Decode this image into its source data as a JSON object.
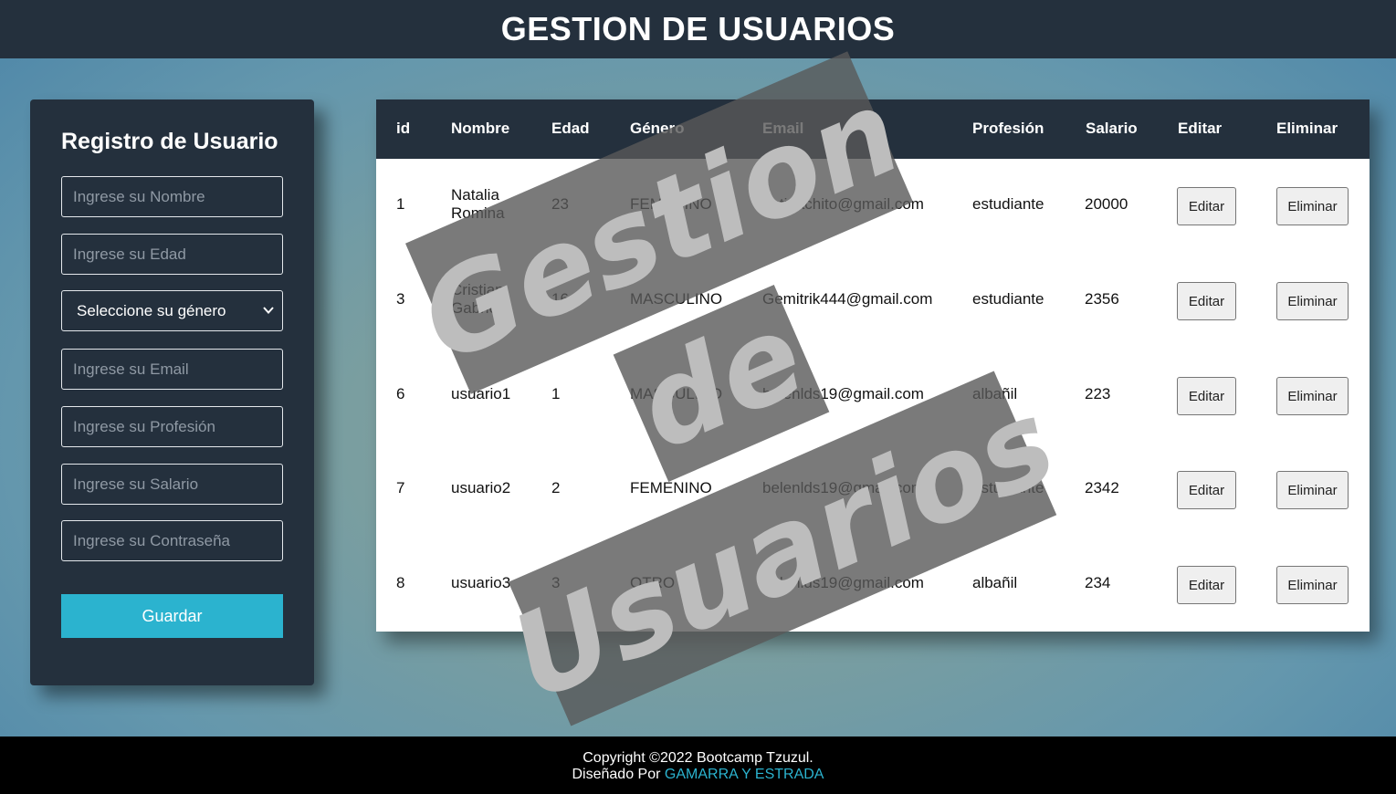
{
  "header": {
    "title": "GESTION DE USUARIOS"
  },
  "form": {
    "title": "Registro de Usuario",
    "fields": {
      "nombre": {
        "placeholder": "Ingrese su Nombre"
      },
      "edad": {
        "placeholder": "Ingrese su Edad"
      },
      "genero": {
        "selected": "Seleccione su género"
      },
      "email": {
        "placeholder": "Ingrese su Email"
      },
      "profesion": {
        "placeholder": "Ingrese su Profesión"
      },
      "salario": {
        "placeholder": "Ingrese su Salario"
      },
      "password": {
        "placeholder": "Ingrese su Contraseña"
      }
    },
    "save_label": "Guardar"
  },
  "table": {
    "headers": [
      "id",
      "Nombre",
      "Edad",
      "Género",
      "Email",
      "Profesión",
      "Salario",
      "Editar",
      "Eliminar"
    ],
    "rows": [
      {
        "id": "1",
        "nombre": "Natalia Romina",
        "edad": "23",
        "genero": "FEMENINO",
        "email": "nati.tachito@gmail.com",
        "profesion": "estudiante",
        "salario": "20000",
        "edit": "Editar",
        "del": "Eliminar"
      },
      {
        "id": "3",
        "nombre": "Cristian Gabriel",
        "edad": "16",
        "genero": "MASCULINO",
        "email": "Gemitrik444@gmail.com",
        "profesion": "estudiante",
        "salario": "2356",
        "edit": "Editar",
        "del": "Eliminar"
      },
      {
        "id": "6",
        "nombre": "usuario1",
        "edad": "1",
        "genero": "MASCULINO",
        "email": "belenlds19@gmail.com",
        "profesion": "albañil",
        "salario": "223",
        "edit": "Editar",
        "del": "Eliminar"
      },
      {
        "id": "7",
        "nombre": "usuario2",
        "edad": "2",
        "genero": "FEMENINO",
        "email": "belenlds19@gmail.com",
        "profesion": "estudiante",
        "salario": "2342",
        "edit": "Editar",
        "del": "Eliminar"
      },
      {
        "id": "8",
        "nombre": "usuario3",
        "edad": "3",
        "genero": "OTRO",
        "email": "belenlds19@gmail.com",
        "profesion": "albañil",
        "salario": "234",
        "edit": "Editar",
        "del": "Eliminar"
      }
    ]
  },
  "watermark": {
    "line1": "Gestion",
    "line2": "de",
    "line3": "Usuarios"
  },
  "footer": {
    "copyright": "Copyright ©2022 Bootcamp Tzuzul.",
    "designed_by_prefix": "Diseñado Por",
    "designed_by_link": "GAMARRA Y ESTRADA"
  },
  "colors": {
    "header_bg": "#24303d",
    "accent": "#2bb3cf",
    "footer_bg": "#000000"
  }
}
